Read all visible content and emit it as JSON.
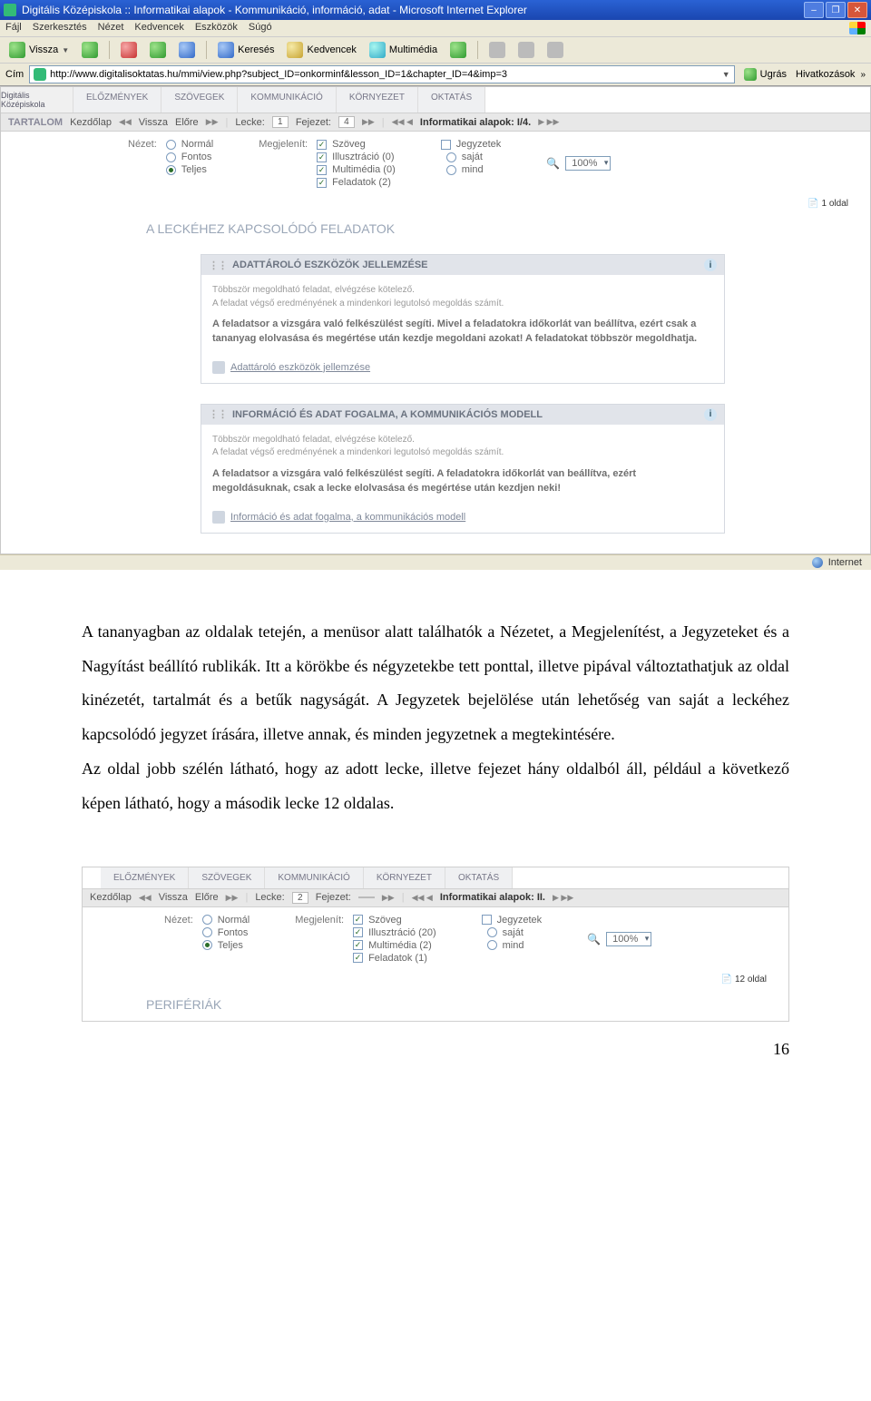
{
  "ie": {
    "title": "Digitális Középiskola :: Informatikai alapok - Kommunikáció, információ, adat - Microsoft Internet Explorer",
    "menus": [
      "Fájl",
      "Szerkesztés",
      "Nézet",
      "Kedvencek",
      "Eszközök",
      "Súgó"
    ],
    "back": "Vissza",
    "search": "Keresés",
    "favorites": "Kedvencek",
    "media": "Multimédia",
    "addr_label": "Cím",
    "url": "http://www.digitalisoktatas.hu/mmi/view.php?subject_ID=onkorminf&lesson_ID=1&chapter_ID=4&imp=3",
    "go": "Ugrás",
    "links": "Hivatkozások",
    "status_left": "",
    "status_right": "Internet"
  },
  "shot1": {
    "logo": "Digitális Középiskola",
    "tabs": [
      "ELŐZMÉNYEK",
      "SZÖVEGEK",
      "KOMMUNIKÁCIÓ",
      "KÖRNYEZET",
      "OKTATÁS"
    ],
    "nav": {
      "tartalom": "TARTALOM",
      "kezdolap": "Kezdőlap",
      "vissza": "Vissza",
      "elore": "Előre",
      "lecke_lbl": "Lecke:",
      "lecke_val": "1",
      "fejezet_lbl": "Fejezet:",
      "fejezet_val": "4",
      "crumb": "Informatikai alapok: I/4."
    },
    "opts": {
      "nezet_lbl": "Nézet:",
      "nezet": [
        "Normál",
        "Fontos",
        "Teljes"
      ],
      "nezet_sel": 2,
      "megj_lbl": "Megjelenít:",
      "megj": [
        "Szöveg",
        "Illusztráció (0)",
        "Multimédia (0)",
        "Feladatok (2)"
      ],
      "jegy_lbl": "Jegyzetek",
      "jegy": [
        "saját",
        "mind"
      ],
      "zoom": "100%"
    },
    "pagecount": "1 oldal",
    "section": "A LECKÉHEZ KAPCSOLÓDÓ FELADATOK",
    "task1": {
      "title": "ADATTÁROLÓ ESZKÖZÖK JELLEMZÉSE",
      "muted1": "Többször megoldható feladat, elvégzése kötelező.",
      "muted2": "A feladat végső eredményének a mindenkori legutolsó megoldás számít.",
      "body": "A feladatsor a vizsgára való felkészülést segíti. Mivel a feladatokra időkorlát van beállítva, ezért csak a tananyag elolvasása és megértése után kezdje megoldani azokat! A feladatokat többször megoldhatja.",
      "link": "Adattároló eszközök jellemzése"
    },
    "task2": {
      "title": "INFORMÁCIÓ ÉS ADAT FOGALMA, A KOMMUNIKÁCIÓS MODELL",
      "muted1": "Többször megoldható feladat, elvégzése kötelező.",
      "muted2": "A feladat végső eredményének a mindenkori legutolsó megoldás számít.",
      "body": "A feladatsor a vizsgára való felkészülést segíti. A feladatokra időkorlát van beállítva, ezért megoldásuknak, csak a lecke elolvasása és megértése után kezdjen neki!",
      "link": "Információ és adat fogalma, a kommunikációs modell"
    }
  },
  "doc": {
    "paragraph": "A tananyagban az oldalak tetején, a menüsor alatt találhatók a Nézetet, a Megjelenítést, a Jegyzeteket és a Nagyítást beállító rublikák. Itt a körökbe és négyzetekbe tett ponttal, illetve pipával változtathatjuk az oldal kinézetét, tartalmát és a betűk nagyságát. A Jegyzetek bejelölése után lehetőség van saját a leckéhez kapcsolódó jegyzet írására, illetve annak, és minden jegyzetnek a megtekintésére.",
    "paragraph2": "Az oldal jobb szélén látható, hogy az adott lecke, illetve fejezet hány oldalból áll, például a következő képen látható, hogy a második lecke 12 oldalas."
  },
  "shot2": {
    "tabs": [
      "ELŐZMÉNYEK",
      "SZÖVEGEK",
      "KOMMUNIKÁCIÓ",
      "KÖRNYEZET",
      "OKTATÁS"
    ],
    "nav": {
      "kezdolap": "Kezdőlap",
      "vissza": "Vissza",
      "elore": "Előre",
      "lecke_lbl": "Lecke:",
      "lecke_val": "2",
      "fejezet_lbl": "Fejezet:",
      "fejezet_val": "",
      "crumb": "Informatikai alapok: II."
    },
    "opts": {
      "nezet_lbl": "Nézet:",
      "nezet": [
        "Normál",
        "Fontos",
        "Teljes"
      ],
      "nezet_sel": 2,
      "megj_lbl": "Megjelenít:",
      "megj": [
        "Szöveg",
        "Illusztráció (20)",
        "Multimédia (2)",
        "Feladatok (1)"
      ],
      "jegy_lbl": "Jegyzetek",
      "jegy": [
        "saját",
        "mind"
      ],
      "zoom": "100%"
    },
    "pagecount": "12 oldal",
    "section": "PERIFÉRIÁK"
  },
  "page_number": "16"
}
